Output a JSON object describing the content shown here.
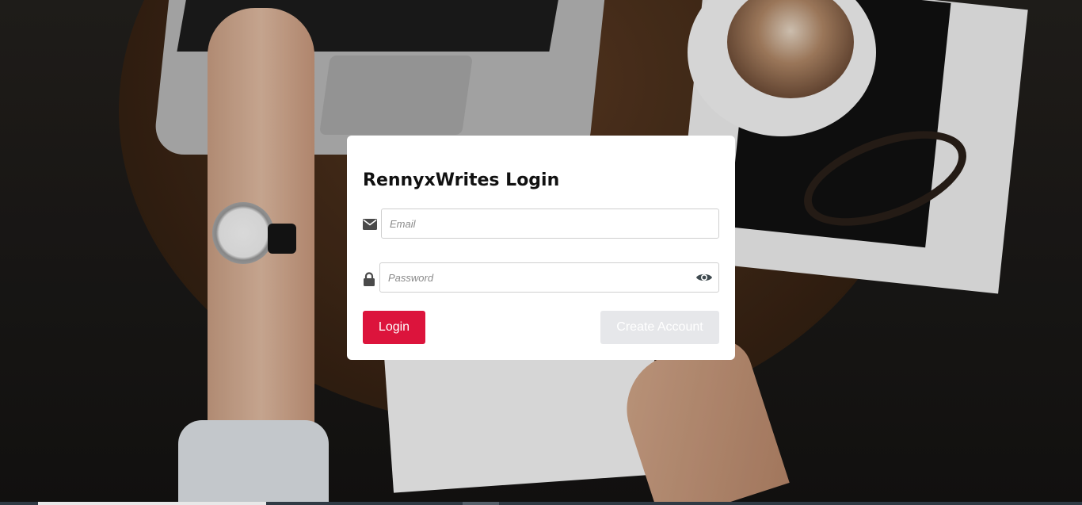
{
  "login": {
    "title": "RennyxWrites Login",
    "email": {
      "placeholder": "Email",
      "value": ""
    },
    "password": {
      "placeholder": "Password",
      "value": ""
    },
    "buttons": {
      "login_label": "Login",
      "create_account_label": "Create Account"
    }
  },
  "icons": {
    "email": "envelope-icon",
    "password": "lock-icon",
    "toggle_password": "eye-icon"
  },
  "colors": {
    "primary_button": "#dc143c",
    "secondary_button": "#e6e7ea",
    "card_background": "#ffffff"
  }
}
